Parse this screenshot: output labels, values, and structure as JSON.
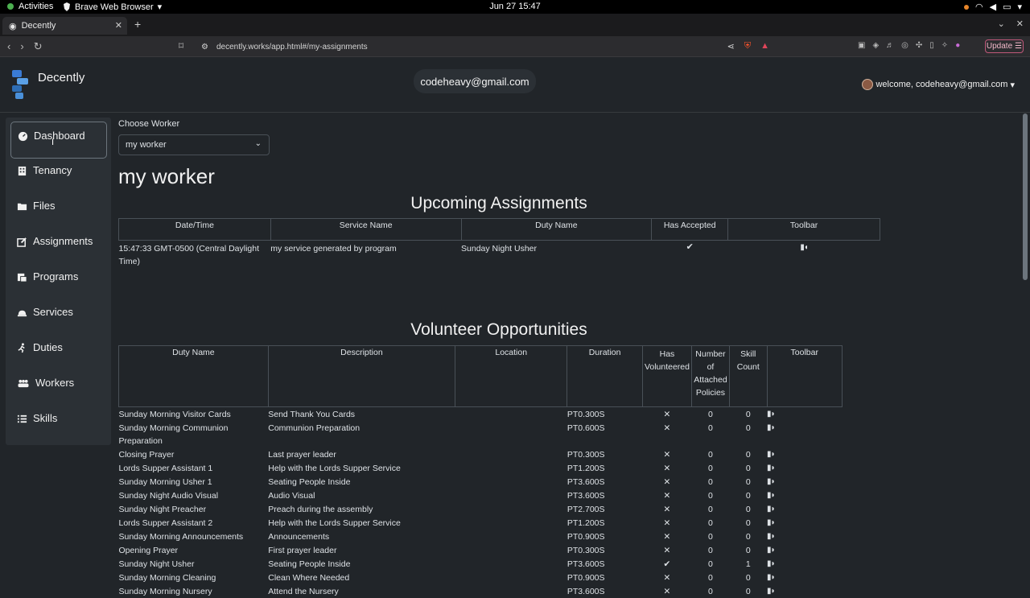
{
  "system": {
    "activities": "Activities",
    "app_name": "Brave Web Browser",
    "clock": "Jun 27  15:47"
  },
  "browser": {
    "tab_title": "Decently",
    "url": "decently.works/app.html#/my-assignments",
    "update_label": "Update"
  },
  "header": {
    "brand": "Decently",
    "email": "codeheavy@gmail.com",
    "welcome": "welcome, codeheavy@gmail.com"
  },
  "sidebar": {
    "items": [
      {
        "label": "Dashboard",
        "icon": "dashboard-icon"
      },
      {
        "label": "Tenancy",
        "icon": "building-icon"
      },
      {
        "label": "Files",
        "icon": "folder-icon"
      },
      {
        "label": "Assignments",
        "icon": "edit-icon"
      },
      {
        "label": "Programs",
        "icon": "programs-icon"
      },
      {
        "label": "Services",
        "icon": "bell-icon"
      },
      {
        "label": "Duties",
        "icon": "runner-icon"
      },
      {
        "label": "Workers",
        "icon": "users-icon"
      },
      {
        "label": "Skills",
        "icon": "list-icon"
      }
    ]
  },
  "main": {
    "choose_label": "Choose Worker",
    "selected_worker": "my worker",
    "worker_title": "my worker",
    "upcoming_title": "Upcoming Assignments",
    "upcoming_headers": [
      "Date/Time",
      "Service Name",
      "Duty Name",
      "Has Accepted",
      "Toolbar"
    ],
    "upcoming_rows": [
      {
        "datetime": "15:47:33 GMT-0500 (Central Daylight Time)",
        "service": "my service generated by program",
        "duty": "Sunday Night Usher",
        "accepted": "✔"
      }
    ],
    "volunteer_title": "Volunteer Opportunities",
    "volunteer_headers": [
      "Duty Name",
      "Description",
      "Location",
      "Duration",
      "Has Volunteered",
      "Number of Attached Policies",
      "Skill Count",
      "Toolbar"
    ],
    "volunteer_rows": [
      {
        "duty": "Sunday Morning Visitor Cards",
        "desc": "Send Thank You Cards",
        "loc": "",
        "dur": "PT0.300S",
        "vol": "✕",
        "pol": "0",
        "skill": "0"
      },
      {
        "duty": "Sunday Morning Communion Preparation",
        "desc": "Communion Preparation",
        "loc": "",
        "dur": "PT0.600S",
        "vol": "✕",
        "pol": "0",
        "skill": "0"
      },
      {
        "duty": "Closing Prayer",
        "desc": "Last prayer leader",
        "loc": "",
        "dur": "PT0.300S",
        "vol": "✕",
        "pol": "0",
        "skill": "0"
      },
      {
        "duty": "Lords Supper Assistant 1",
        "desc": "Help with the Lords Supper Service",
        "loc": "",
        "dur": "PT1.200S",
        "vol": "✕",
        "pol": "0",
        "skill": "0"
      },
      {
        "duty": "Sunday Morning Usher 1",
        "desc": "Seating People Inside",
        "loc": "",
        "dur": "PT3.600S",
        "vol": "✕",
        "pol": "0",
        "skill": "0"
      },
      {
        "duty": "Sunday Night Audio Visual",
        "desc": "Audio Visual",
        "loc": "",
        "dur": "PT3.600S",
        "vol": "✕",
        "pol": "0",
        "skill": "0"
      },
      {
        "duty": "Sunday Night Preacher",
        "desc": "Preach during the assembly",
        "loc": "",
        "dur": "PT2.700S",
        "vol": "✕",
        "pol": "0",
        "skill": "0"
      },
      {
        "duty": "Lords Supper Assistant 2",
        "desc": "Help with the Lords Supper Service",
        "loc": "",
        "dur": "PT1.200S",
        "vol": "✕",
        "pol": "0",
        "skill": "0"
      },
      {
        "duty": "Sunday Morning Announcements",
        "desc": "Announcements",
        "loc": "",
        "dur": "PT0.900S",
        "vol": "✕",
        "pol": "0",
        "skill": "0"
      },
      {
        "duty": "Opening Prayer",
        "desc": "First prayer leader",
        "loc": "",
        "dur": "PT0.300S",
        "vol": "✕",
        "pol": "0",
        "skill": "0"
      },
      {
        "duty": "Sunday Night Usher",
        "desc": "Seating People Inside",
        "loc": "",
        "dur": "PT3.600S",
        "vol": "✔",
        "pol": "0",
        "skill": "1"
      },
      {
        "duty": "Sunday Morning Cleaning",
        "desc": "Clean Where Needed",
        "loc": "",
        "dur": "PT0.900S",
        "vol": "✕",
        "pol": "0",
        "skill": "0"
      },
      {
        "duty": "Sunday Morning Nursery",
        "desc": "Attend the Nursery",
        "loc": "",
        "dur": "PT3.600S",
        "vol": "✕",
        "pol": "0",
        "skill": "0"
      }
    ]
  }
}
